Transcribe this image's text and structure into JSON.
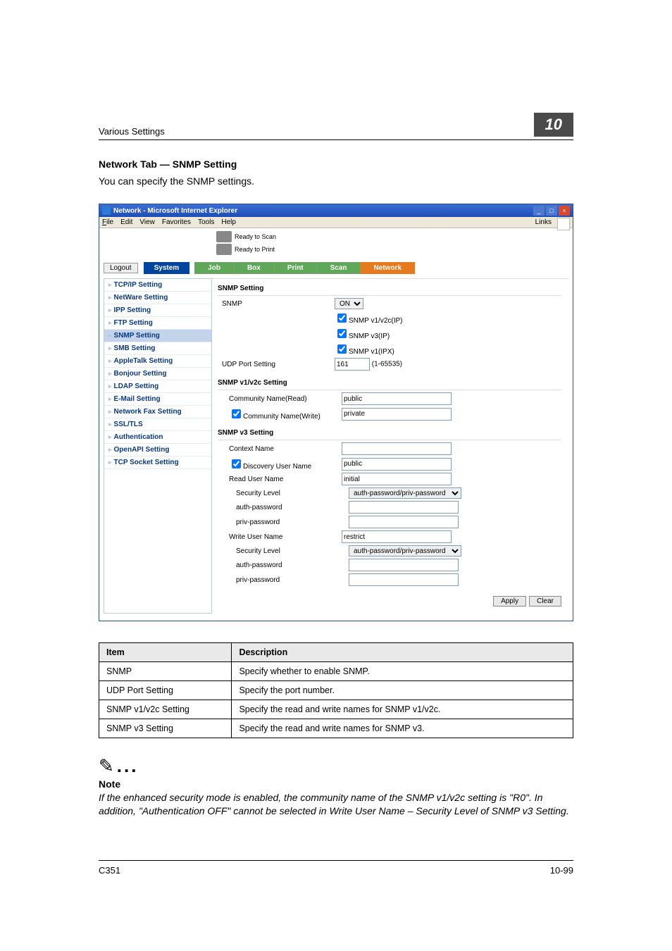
{
  "header": {
    "left": "Various Settings",
    "chapter": "10"
  },
  "section": {
    "title": "Network Tab — SNMP Setting",
    "intro": "You can specify the SNMP settings."
  },
  "ie": {
    "title": "Network - Microsoft Internet Explorer",
    "menu": {
      "file": "File",
      "edit": "Edit",
      "view": "View",
      "favorites": "Favorites",
      "tools": "Tools",
      "help": "Help",
      "links": "Links"
    },
    "status": {
      "scan": "Ready to Scan",
      "print": "Ready to Print"
    },
    "logout": "Logout",
    "tabs": {
      "system": "System",
      "job": "Job",
      "box": "Box",
      "print": "Print",
      "scan": "Scan",
      "network": "Network"
    },
    "sidebar": [
      "TCP/IP Setting",
      "NetWare Setting",
      "IPP Setting",
      "FTP Setting",
      "SNMP Setting",
      "SMB Setting",
      "AppleTalk Setting",
      "Bonjour Setting",
      "LDAP Setting",
      "E-Mail Setting",
      "Network Fax Setting",
      "SSL/TLS",
      "Authentication",
      "OpenAPI Setting",
      "TCP Socket Setting"
    ],
    "sidebar_current_index": 4,
    "form": {
      "head1": "SNMP Setting",
      "snmp_label": "SNMP",
      "snmp_on": "ON",
      "opt_ip12": "SNMP v1/v2c(IP)",
      "opt_ip3": "SNMP v3(IP)",
      "opt_ipx": "SNMP v1(IPX)",
      "udp_label": "UDP Port Setting",
      "udp_value": "161",
      "udp_range": "(1-65535)",
      "head2": "SNMP v1/v2c Setting",
      "comm_read_label": "Community Name(Read)",
      "comm_read_value": "public",
      "comm_write_label": "Community Name(Write)",
      "comm_write_value": "private",
      "head3": "SNMP v3 Setting",
      "ctx_label": "Context Name",
      "disc_user_label": "Discovery User Name",
      "disc_user_value": "public",
      "read_user_label": "Read User Name",
      "read_user_value": "initial",
      "sec_level_label": "Security Level",
      "sec_level_value": "auth-password/priv-password",
      "authpw_label": "auth-password",
      "privpw_label": "priv-password",
      "write_user_label": "Write User Name",
      "write_user_value": "restrict",
      "apply": "Apply",
      "clear": "Clear"
    }
  },
  "table": {
    "h1": "Item",
    "h2": "Description",
    "rows": [
      {
        "item": "SNMP",
        "desc": "Specify whether to enable SNMP."
      },
      {
        "item": "UDP Port Setting",
        "desc": "Specify the port number."
      },
      {
        "item": "SNMP v1/v2c Setting",
        "desc": "Specify the read and write names for SNMP v1/v2c."
      },
      {
        "item": "SNMP v3 Setting",
        "desc": "Specify the read and write names for SNMP v3."
      }
    ]
  },
  "note": {
    "head": "Note",
    "body": "If the enhanced security mode is enabled, the community name of the SNMP v1/v2c setting is \"R0\". In addition, \"Authentication OFF\" cannot be selected in Write User Name – Security Level of SNMP v3 Setting."
  },
  "footer": {
    "left": "C351",
    "right": "10-99"
  }
}
